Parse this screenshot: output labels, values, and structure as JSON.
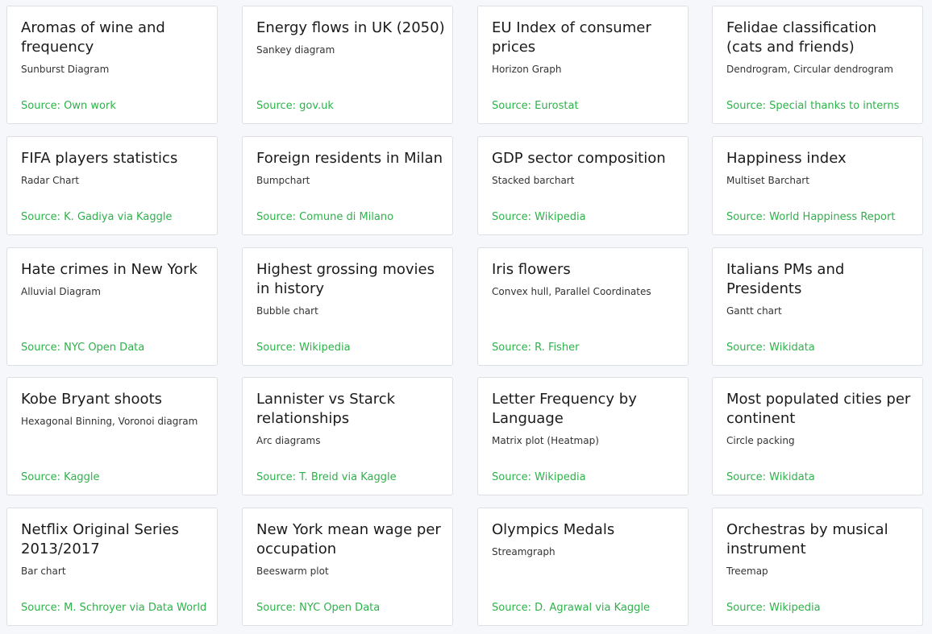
{
  "colors": {
    "source_accent": "#2db24a",
    "page_background": "#f5f7fa",
    "card_background": "#ffffff",
    "card_border": "#dcdfe4"
  },
  "cards": [
    {
      "title": "Aromas of wine and frequency",
      "type": "Sunburst Diagram",
      "source": "Source: Own work"
    },
    {
      "title": "Energy flows in UK (2050)",
      "type": "Sankey diagram",
      "source": "Source: gov.uk"
    },
    {
      "title": "EU Index of consumer prices",
      "type": "Horizon Graph",
      "source": "Source: Eurostat"
    },
    {
      "title": "Felidae classification (cats and friends)",
      "type": "Dendrogram, Circular dendrogram",
      "source": "Source: Special thanks to interns"
    },
    {
      "title": "FIFA players statistics",
      "type": "Radar Chart",
      "source": "Source: K. Gadiya via Kaggle"
    },
    {
      "title": "Foreign residents in Milan",
      "type": "Bumpchart",
      "source": "Source: Comune di Milano"
    },
    {
      "title": "GDP sector composition",
      "type": "Stacked barchart",
      "source": "Source: Wikipedia"
    },
    {
      "title": "Happiness index",
      "type": "Multiset Barchart",
      "source": "Source: World Happiness Report"
    },
    {
      "title": "Hate crimes in New York",
      "type": "Alluvial Diagram",
      "source": "Source: NYC Open Data"
    },
    {
      "title": "Highest grossing movies in history",
      "type": "Bubble chart",
      "source": "Source: Wikipedia"
    },
    {
      "title": "Iris flowers",
      "type": "Convex hull, Parallel Coordinates",
      "source": "Source: R. Fisher"
    },
    {
      "title": "Italians PMs and Presidents",
      "type": "Gantt chart",
      "source": "Source: Wikidata"
    },
    {
      "title": "Kobe Bryant shoots",
      "type": "Hexagonal Binning, Voronoi diagram",
      "source": "Source: Kaggle"
    },
    {
      "title": "Lannister vs Starck relationships",
      "type": "Arc diagrams",
      "source": "Source: T. Breid via Kaggle"
    },
    {
      "title": "Letter Frequency by Language",
      "type": "Matrix plot (Heatmap)",
      "source": "Source: Wikipedia"
    },
    {
      "title": "Most populated cities per continent",
      "type": "Circle packing",
      "source": "Source: Wikidata"
    },
    {
      "title": "Netflix Original Series 2013/2017",
      "type": "Bar chart",
      "source": "Source: M. Schroyer via Data World"
    },
    {
      "title": "New York mean wage per occupation",
      "type": "Beeswarm plot",
      "source": "Source: NYC Open Data"
    },
    {
      "title": "Olympics Medals",
      "type": "Streamgraph",
      "source": "Source: D. Agrawal via Kaggle"
    },
    {
      "title": "Orchestras by musical instrument",
      "type": "Treemap",
      "source": "Source: Wikipedia"
    }
  ]
}
